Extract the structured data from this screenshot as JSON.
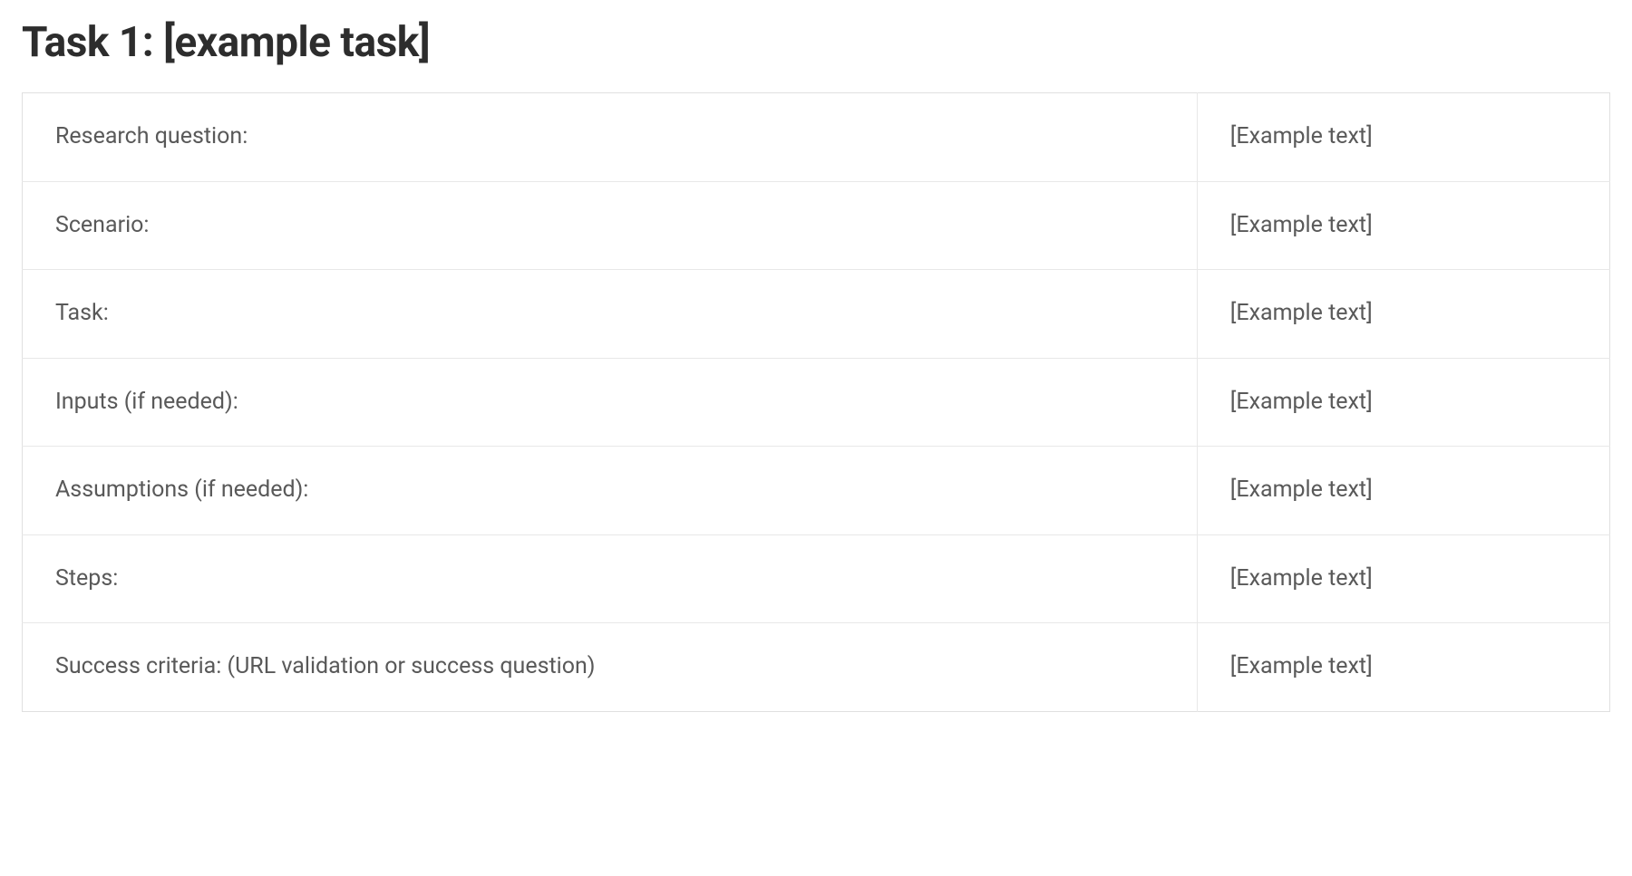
{
  "heading": "Task 1: [example task]",
  "rows": [
    {
      "label": "Research question:",
      "value": "[Example text]"
    },
    {
      "label": "Scenario:",
      "value": "[Example text]"
    },
    {
      "label": "Task:",
      "value": "[Example text]"
    },
    {
      "label": "Inputs (if needed):",
      "value": "[Example text]"
    },
    {
      "label": "Assumptions (if needed):",
      "value": "[Example text]"
    },
    {
      "label": "Steps:",
      "value": "[Example text]"
    },
    {
      "label": "Success criteria: (URL validation or success question)",
      "value": "[Example text]"
    }
  ]
}
